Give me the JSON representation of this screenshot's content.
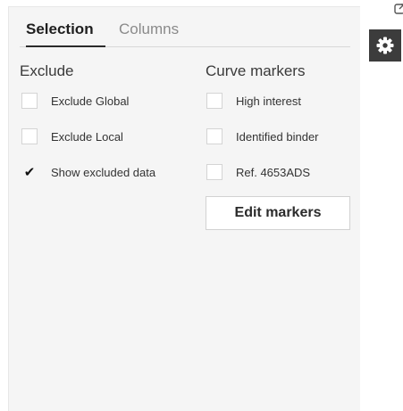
{
  "tabs": [
    {
      "label": "Selection",
      "active": true
    },
    {
      "label": "Columns",
      "active": false
    }
  ],
  "exclude": {
    "title": "Exclude",
    "options": [
      {
        "label": "Exclude Global",
        "checked": false
      },
      {
        "label": "Exclude Local",
        "checked": false
      },
      {
        "label": "Show excluded data",
        "checked": true
      }
    ]
  },
  "curve_markers": {
    "title": "Curve markers",
    "options": [
      {
        "label": "High interest",
        "checked": false
      },
      {
        "label": "Identified binder",
        "checked": false
      },
      {
        "label": "Ref. 4653ADS",
        "checked": false
      }
    ],
    "edit_button_label": "Edit markers"
  },
  "toolbar": {
    "settings_icon": "gear-icon",
    "popout_icon": "popout-icon"
  },
  "colors": {
    "panel_bg": "#f5f5f5",
    "gear_button_bg": "#3c3c3c"
  }
}
